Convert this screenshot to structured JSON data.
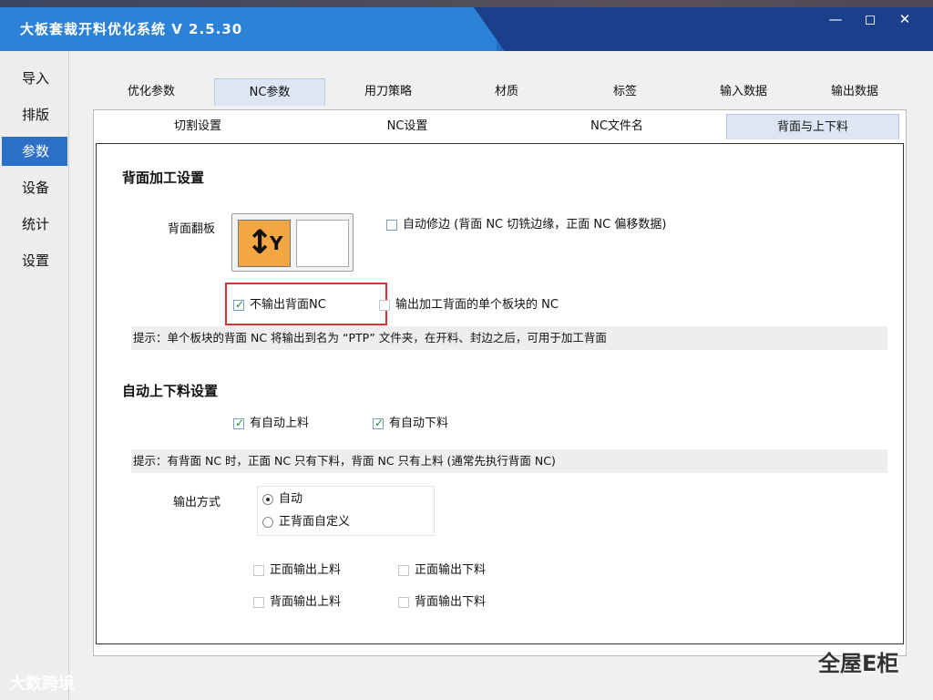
{
  "window": {
    "title": "大板套裁开料优化系统  V 2.5.30",
    "controls": {
      "min": "—",
      "max": "◻",
      "close": "✕"
    }
  },
  "sidebar": {
    "items": [
      {
        "label": "导入",
        "active": false
      },
      {
        "label": "排版",
        "active": false
      },
      {
        "label": "参数",
        "active": true
      },
      {
        "label": "设备",
        "active": false
      },
      {
        "label": "统计",
        "active": false
      },
      {
        "label": "设置",
        "active": false
      }
    ]
  },
  "tabs": [
    {
      "label": "优化参数"
    },
    {
      "label": "NC参数",
      "active": true
    },
    {
      "label": "用刀策略"
    },
    {
      "label": "材质"
    },
    {
      "label": "标签"
    },
    {
      "label": "输入数据"
    },
    {
      "label": "输出数据"
    }
  ],
  "subtabs": [
    {
      "label": "切割设置"
    },
    {
      "label": "NC设置"
    },
    {
      "label": "NC文件名"
    },
    {
      "label": "背面与上下料",
      "active": true
    }
  ],
  "back_section": {
    "title": "背面加工设置",
    "flip_label": "背面翻板",
    "flip_arrow": "↕",
    "flip_letter": "Y",
    "auto_trim": "自动修边 (背面 NC 切铣边缘，正面 NC 偏移数据)",
    "no_output_back_nc": "不输出背面NC",
    "output_single_back_nc": "输出加工背面的单个板块的 NC",
    "hint": "提示：单个板块的背面 NC 将输出到名为 “PTP” 文件夹，在开料、封边之后，可用于加工背面"
  },
  "loading_section": {
    "title": "自动上下料设置",
    "auto_load": "有自动上料",
    "auto_unload": "有自动下料",
    "hint": "提示：有背面 NC 时，正面 NC 只有下料，背面 NC 只有上料 (通常先执行背面 NC)",
    "output_mode_label": "输出方式",
    "mode_auto": "自动",
    "mode_custom": "正背面自定义",
    "front_load": "正面输出上料",
    "front_unload": "正面输出下料",
    "back_load": "背面输出上料",
    "back_unload": "背面输出下料"
  },
  "check": "✓",
  "watermarks": {
    "left": "大数跨境",
    "right": "全屋E柜"
  }
}
